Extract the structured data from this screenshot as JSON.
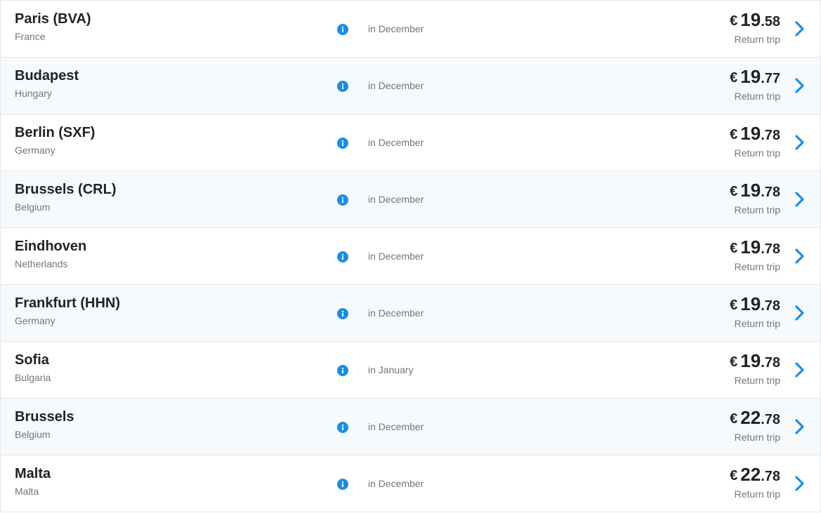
{
  "colors": {
    "accent": "#1a8ee5",
    "row_alt": "#f6fafd",
    "border": "#e3e6ea",
    "text_primary": "#222222",
    "text_secondary": "#757575"
  },
  "icons": {
    "info": "info-icon",
    "next": "chevron-right-icon"
  },
  "destinations": [
    {
      "city": "Paris (BVA)",
      "country": "France",
      "period": "in December",
      "currency": "€",
      "price_int": "19",
      "price_dec": ".58",
      "trip_type": "Return trip"
    },
    {
      "city": "Budapest",
      "country": "Hungary",
      "period": "in December",
      "currency": "€",
      "price_int": "19",
      "price_dec": ".77",
      "trip_type": "Return trip"
    },
    {
      "city": "Berlin (SXF)",
      "country": "Germany",
      "period": "in December",
      "currency": "€",
      "price_int": "19",
      "price_dec": ".78",
      "trip_type": "Return trip"
    },
    {
      "city": "Brussels (CRL)",
      "country": "Belgium",
      "period": "in December",
      "currency": "€",
      "price_int": "19",
      "price_dec": ".78",
      "trip_type": "Return trip"
    },
    {
      "city": "Eindhoven",
      "country": "Netherlands",
      "period": "in December",
      "currency": "€",
      "price_int": "19",
      "price_dec": ".78",
      "trip_type": "Return trip"
    },
    {
      "city": "Frankfurt (HHN)",
      "country": "Germany",
      "period": "in December",
      "currency": "€",
      "price_int": "19",
      "price_dec": ".78",
      "trip_type": "Return trip"
    },
    {
      "city": "Sofia",
      "country": "Bulgaria",
      "period": "in January",
      "currency": "€",
      "price_int": "19",
      "price_dec": ".78",
      "trip_type": "Return trip"
    },
    {
      "city": "Brussels",
      "country": "Belgium",
      "period": "in December",
      "currency": "€",
      "price_int": "22",
      "price_dec": ".78",
      "trip_type": "Return trip"
    },
    {
      "city": "Malta",
      "country": "Malta",
      "period": "in December",
      "currency": "€",
      "price_int": "22",
      "price_dec": ".78",
      "trip_type": "Return trip"
    }
  ]
}
